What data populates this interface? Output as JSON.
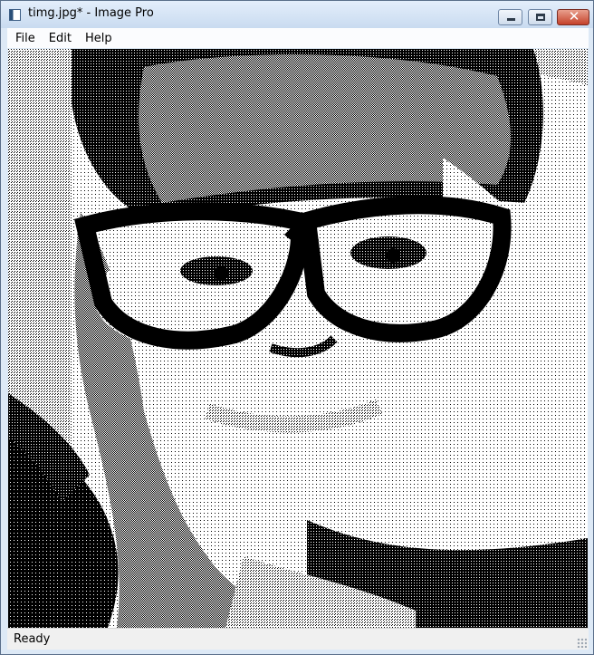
{
  "window": {
    "title": "timg.jpg* - Image Pro",
    "close_glyph": "✕"
  },
  "menu": [
    "File",
    "Edit",
    "Help"
  ],
  "canvas": {
    "description_icon": "dithered-photo"
  },
  "status": {
    "text": "Ready"
  }
}
